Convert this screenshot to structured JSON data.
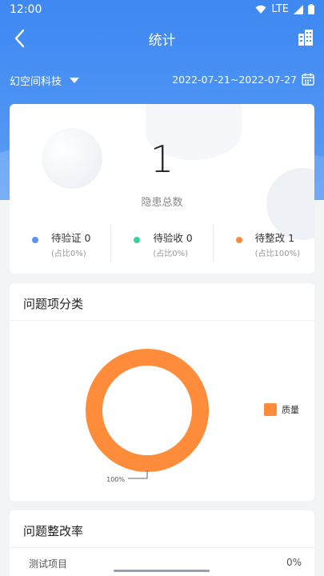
{
  "status": {
    "time": "12:00",
    "network": "LTE"
  },
  "header": {
    "title": "统计"
  },
  "filter": {
    "company": "幻空间科技",
    "date_range": "2022-07-21~2022-07-27"
  },
  "summary": {
    "total": "1",
    "total_label": "隐患总数",
    "items": [
      {
        "label": "待验证 0",
        "sub": "(占比0%)",
        "color": "#5b8ff9"
      },
      {
        "label": "待验收 0",
        "sub": "(占比0%)",
        "color": "#3ccf9a"
      },
      {
        "label": "待整改 1",
        "sub": "(占比100%)",
        "color": "#ff8c3a"
      }
    ]
  },
  "category": {
    "title": "问题项分类",
    "chart_data": {
      "type": "pie",
      "categories": [
        "质量"
      ],
      "values": [
        100
      ],
      "data_labels": [
        "100%"
      ],
      "colors": [
        "#ff8c3a"
      ],
      "legend": "right"
    }
  },
  "rate": {
    "title": "问题整改率",
    "row_name": "测试项目",
    "row_value": "0%"
  }
}
